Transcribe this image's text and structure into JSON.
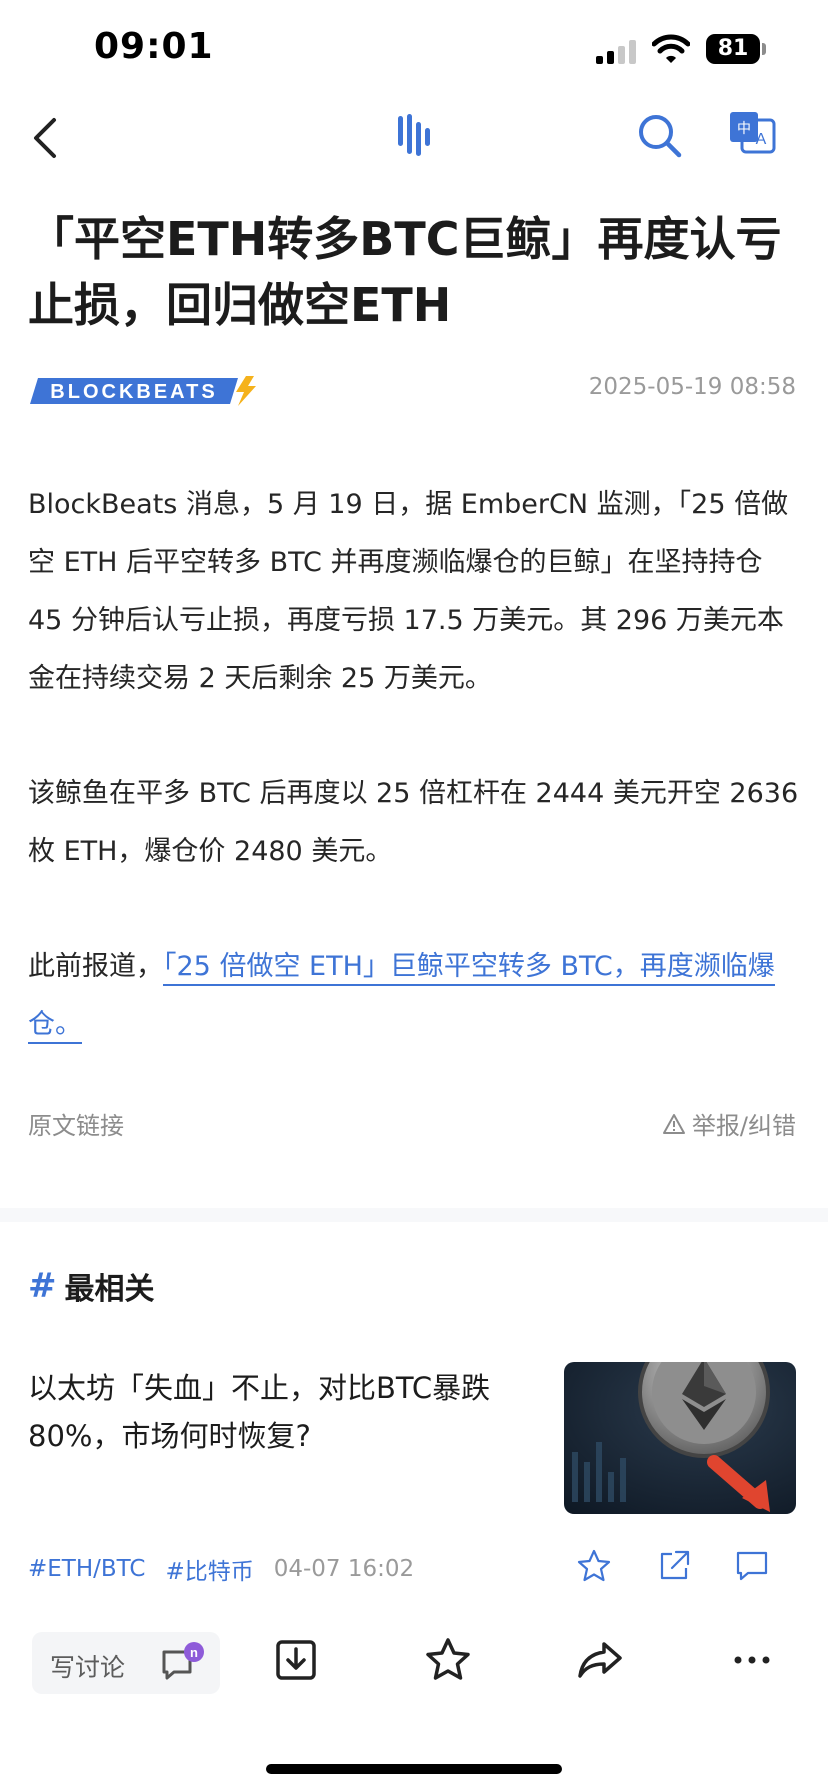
{
  "status_bar": {
    "time": "09:01",
    "battery": "81"
  },
  "article": {
    "title": "「平空ETH转多BTC巨鲸」再度认亏止损，回归做空ETH",
    "source_brand": "BLOCKBEATS",
    "date": "2025-05-19 08:58",
    "paragraph1": "BlockBeats 消息，5 月 19 日，据 EmberCN 监测，「25 倍做空 ETH 后平空转多 BTC 并再度濒临爆仓的巨鲸」在坚持持仓 45 分钟后认亏止损，再度亏损 17.5 万美元。其 296 万美元本金在持续交易 2 天后剩余 25 万美元。",
    "paragraph2": "该鲸鱼在平多 BTC 后再度以 25 倍杠杆在 2444 美元开空 2636 枚 ETH，爆仓价 2480 美元。",
    "paragraph3_prefix": "此前报道，",
    "paragraph3_link": "「25 倍做空 ETH」巨鲸平空转多 BTC，再度濒临爆仓。",
    "source_link": "原文链接",
    "report": "举报/纠错"
  },
  "related": {
    "heading": "最相关",
    "hash": "#",
    "item": {
      "title": "以太坊「失血」不止，对比BTC暴跌80%，市场何时恢复?",
      "tags": [
        "#ETH/BTC",
        "#比特币"
      ],
      "date": "04-07 16:02"
    }
  },
  "bottom_bar": {
    "comment_placeholder": "写讨论"
  },
  "colors": {
    "accent": "#3e74d6",
    "muted": "#9a9a9a"
  }
}
